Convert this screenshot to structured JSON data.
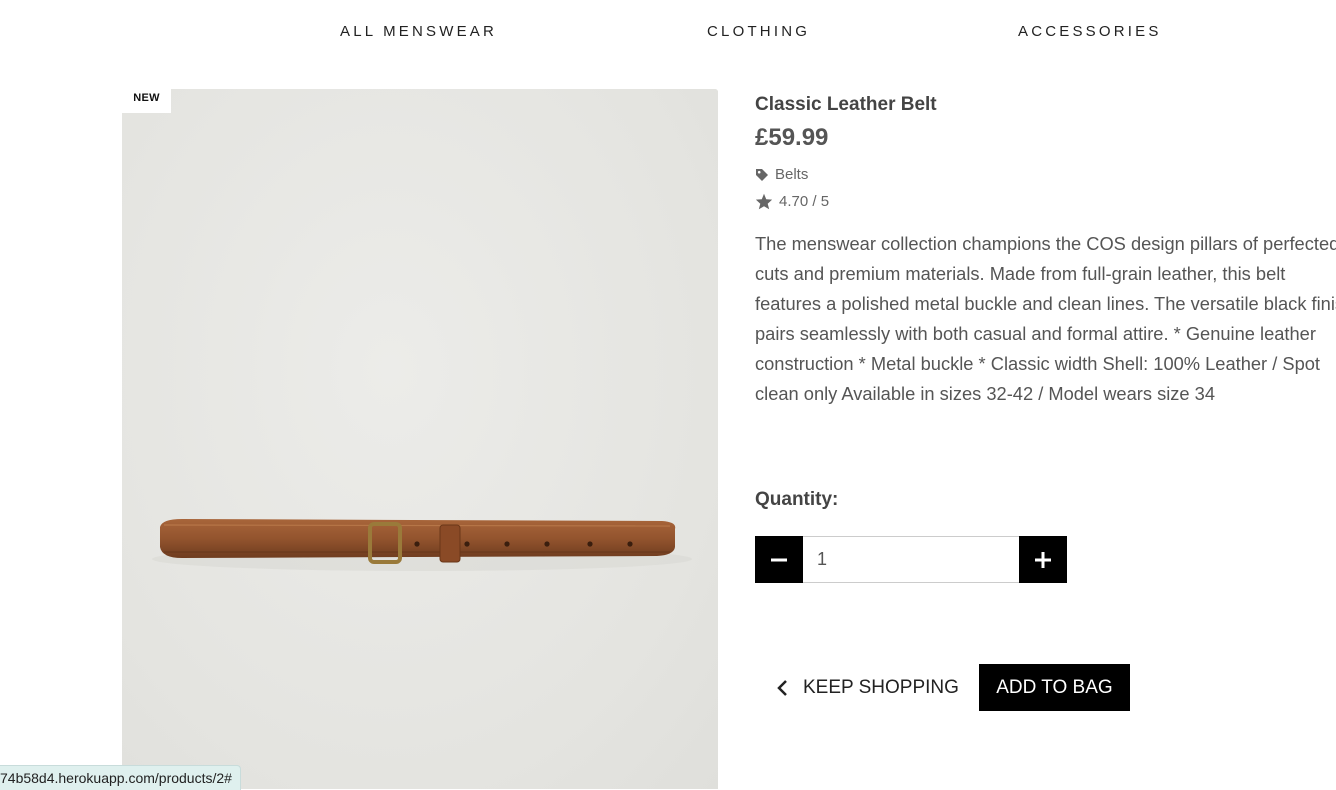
{
  "nav": {
    "items": [
      "ALL MENSWEAR",
      "CLOTHING",
      "ACCESSORIES"
    ]
  },
  "product": {
    "badge": "NEW",
    "name": "Classic Leather Belt",
    "price": "£59.99",
    "category": "Belts",
    "rating": "4.70 / 5",
    "description": "The menswear collection champions the COS design pillars of perfected cuts and premium materials. Made from full-grain leather, this belt features a polished metal buckle and clean lines. The versatile black finish pairs seamlessly with both casual and formal attire. * Genuine leather construction * Metal buckle * Classic width Shell: 100% Leather / Spot clean only Available in sizes 32-42 / Model wears size 34"
  },
  "quantity": {
    "label": "Quantity:",
    "value": "1"
  },
  "actions": {
    "keep_shopping": "KEEP SHOPPING",
    "add_to_bag": "ADD TO BAG"
  },
  "status_bar": {
    "url": "74b58d4.herokuapp.com/products/2#"
  },
  "icons": {
    "category": "tag-icon",
    "rating": "star-icon",
    "minus": "minus-icon",
    "plus": "plus-icon",
    "back": "chevron-left-icon"
  },
  "colors": {
    "image_bg": "#e6e6e2",
    "button_bg": "#000000",
    "belt": "#9a5a32",
    "status_bg": "#dff0ee"
  }
}
